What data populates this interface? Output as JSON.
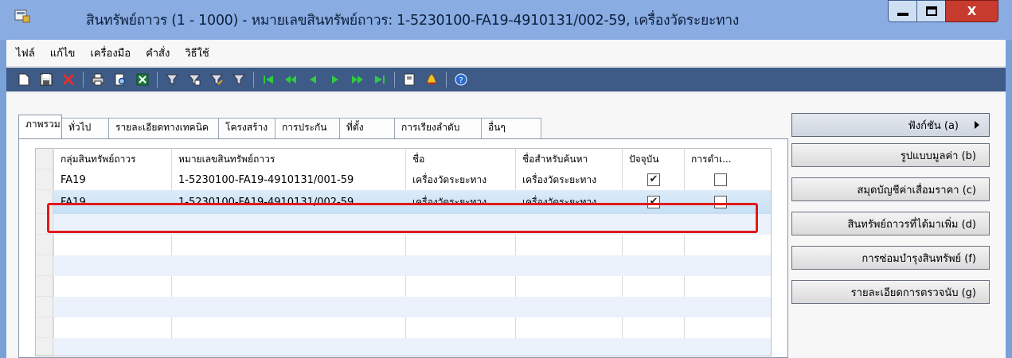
{
  "window": {
    "title": "สินทรัพย์ถาวร (1 - 1000) - หมายเลขสินทรัพย์ถาวร: 1-5230100-FA19-4910131/002-59, เครื่องวัดระยะทาง",
    "close_label": "X"
  },
  "menu": [
    "ไฟล์",
    "แก้ไข",
    "เครื่องมือ",
    "คำสั่ง",
    "วิธีใช้"
  ],
  "toolbar": {
    "icons": [
      "new-icon",
      "save-icon",
      "delete-icon",
      "print-icon",
      "print-preview-icon",
      "export-excel-icon",
      "filter-icon",
      "filter-by-selection-icon",
      "advanced-filter-icon",
      "clear-filter-icon",
      "first-record-icon",
      "previous-page-icon",
      "previous-record-icon",
      "next-record-icon",
      "next-page-icon",
      "last-record-icon",
      "document-handling-icon",
      "alert-icon",
      "help-icon"
    ]
  },
  "tabs": [
    "ภาพรวม",
    "ทั่วไป",
    "รายละเอียดทางเทคนิค",
    "โครงสร้าง",
    "การประกัน",
    "ที่ตั้ง",
    "การเรียงลำดับ",
    "อื่นๆ"
  ],
  "grid": {
    "headers": [
      "กลุ่มสินทรัพย์ถาวร",
      "หมายเลขสินทรัพย์ถาวร",
      "ชื่อ",
      "ชื่อสำหรับค้นหา",
      "ปัจจุบัน",
      "การดำเ..."
    ],
    "rows": [
      {
        "group": "FA19",
        "number": "1-5230100-FA19-4910131/001-59",
        "name": "เครื่องวัดระยะทาง",
        "search_name": "เครื่องวัดระยะทาง",
        "current": true,
        "other": false
      },
      {
        "group": "FA19",
        "number": "1-5230100-FA19-4910131/002-59",
        "name": "เครื่องวัดระยะทาง",
        "search_name": "เครื่องวัดระยะทาง",
        "current": true,
        "other": false
      }
    ],
    "selected_row": 1
  },
  "side_buttons": [
    "ฟังก์ชัน (a)",
    "รูปแบบมูลค่า (b)",
    "สมุดบัญชีค่าเสื่อมราคา (c)",
    "สินทรัพย์ถาวรที่ได้มาเพิ่ม (d)",
    "การซ่อมบำรุงสินทรัพย์ (f)",
    "รายละเอียดการตรวจนับ (g)"
  ],
  "colors": {
    "highlight": "#e01a1a",
    "toolbar": "#3e5a86",
    "titlebar": "#89ace3"
  }
}
